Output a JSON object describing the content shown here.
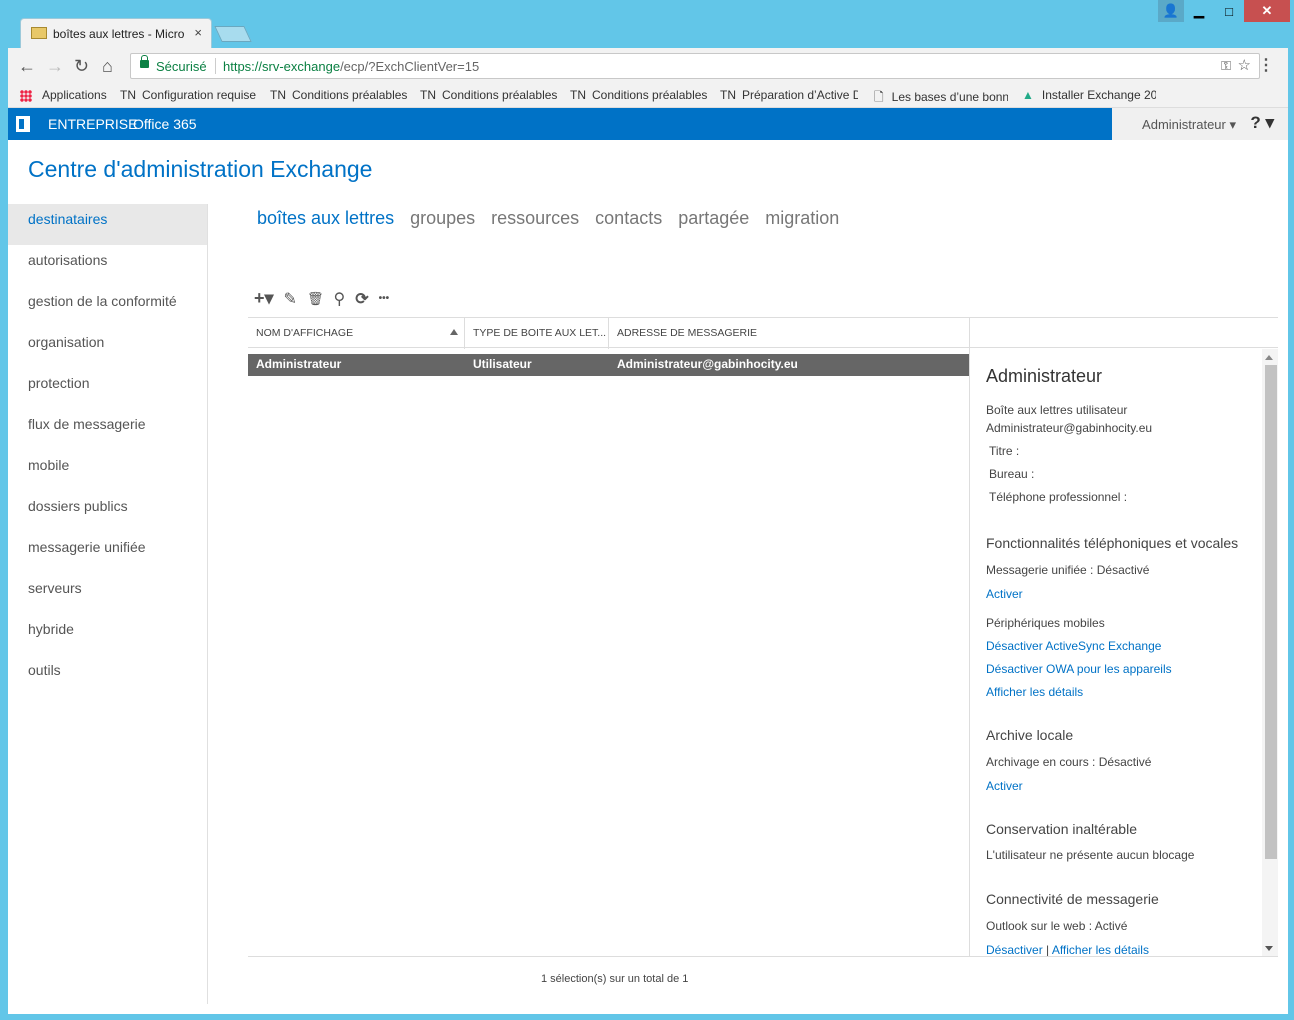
{
  "browser": {
    "tab_title": "boîtes aux lettres - Micro",
    "tab_close": "×",
    "win_buttons": {
      "user": "👤",
      "minimize": "▁",
      "maximize": "□",
      "close": "✕"
    },
    "secure_label": "Sécurisé",
    "url_scheme_host": "https://srv-exchange",
    "url_rest": "/ecp/?ExchClientVer=15",
    "nav_icons": {
      "back": "←",
      "forward": "→",
      "reload": "↻",
      "home": "⌂"
    },
    "bookmarks": [
      {
        "prefix": "",
        "label": "Applications"
      },
      {
        "prefix": "TN",
        "label": "Configuration requise"
      },
      {
        "prefix": "TN",
        "label": "Conditions préalables"
      },
      {
        "prefix": "TN",
        "label": "Conditions préalables"
      },
      {
        "prefix": "TN",
        "label": "Conditions préalables"
      },
      {
        "prefix": "TN",
        "label": "Préparation d’Active D"
      },
      {
        "prefix": "",
        "label": "Les bases d’une bonn"
      },
      {
        "prefix": "",
        "label": "Installer Exchange 20"
      }
    ]
  },
  "o365": {
    "enterprise": "ENTREPRISE",
    "office365": "Office 365",
    "admin": "Administrateur ▾",
    "help": "? ▾"
  },
  "app_title": "Centre d'administration Exchange",
  "leftnav": [
    "destinataires",
    "autorisations",
    "gestion de la conformité",
    "organisation",
    "protection",
    "flux de messagerie",
    "mobile",
    "dossiers publics",
    "messagerie unifiée",
    "serveurs",
    "hybride",
    "outils"
  ],
  "subtabs": [
    "boîtes aux lettres",
    "groupes",
    "ressources",
    "contacts",
    "partagée",
    "migration"
  ],
  "actions": {
    "add": "+▾",
    "edit": "✎",
    "delete": "🗑",
    "search": "⚲",
    "refresh": "⟳",
    "more": "•••"
  },
  "grid": {
    "columns": [
      "NOM D'AFFICHAGE",
      "TYPE DE BOITE AUX LET...",
      "ADRESSE DE MESSAGERIE"
    ],
    "rows": [
      {
        "name": "Administrateur",
        "type": "Utilisateur",
        "email": "Administrateur@gabinhocity.eu"
      }
    ],
    "status": "1 sélection(s) sur un total de 1"
  },
  "details": {
    "title": "Administrateur",
    "mailbox_type": "Boîte aux lettres utilisateur",
    "email": "Administrateur@gabinhocity.eu",
    "titre": "Titre :",
    "bureau": "Bureau :",
    "telephone": "Téléphone professionnel :",
    "voice_section": "Fonctionnalités téléphoniques et vocales",
    "um_label": "Messagerie unifiée :  Désactivé",
    "um_link": "Activer",
    "mobile_label": "Périphériques mobiles",
    "mobile_link1": "Désactiver ActiveSync Exchange",
    "mobile_link2": "Désactiver OWA pour les appareils",
    "mobile_link3": "Afficher les détails",
    "archive_section": "Archive locale",
    "archive_label": "Archivage en cours :  Désactivé",
    "archive_link": "Activer",
    "hold_section": "Conservation inaltérable",
    "hold_text": "L'utilisateur ne présente aucun blocage",
    "conn_section": "Connectivité de messagerie",
    "owa_label": "Outlook sur le web :  Activé",
    "owa_link1": "Désactiver",
    "owa_sep": " | ",
    "owa_link2": "Afficher les détails"
  }
}
